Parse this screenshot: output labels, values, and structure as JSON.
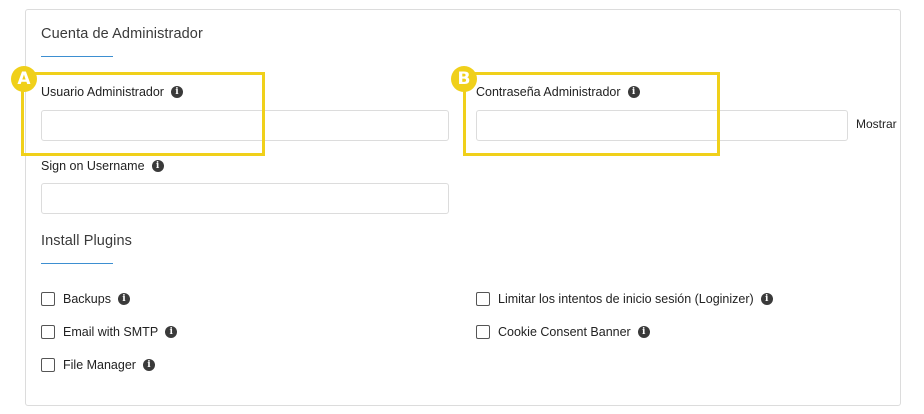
{
  "admin_section": {
    "title": "Cuenta de Administrador",
    "admin_user_label": "Usuario Administrador",
    "admin_user_value": "",
    "admin_pass_label": "Contraseña Administrador",
    "admin_pass_value": "",
    "show_label": "Mostrar",
    "sign_on_label": "Sign on Username",
    "sign_on_value": ""
  },
  "plugins_section": {
    "title": "Install Plugins",
    "left": [
      {
        "label": "Backups",
        "checked": false
      },
      {
        "label": "Email with SMTP",
        "checked": false
      },
      {
        "label": "File Manager",
        "checked": false
      }
    ],
    "right": [
      {
        "label": "Limitar los intentos de inicio sesión (Loginizer)",
        "checked": false
      },
      {
        "label": "Cookie Consent Banner",
        "checked": false
      }
    ]
  },
  "annotations": {
    "a": "A",
    "b": "B",
    "color": "#f0d01a"
  },
  "icons": {
    "info": "info-circle-icon"
  },
  "colors": {
    "accent_underline": "#3d8fd1",
    "border": "#dcdcdc"
  }
}
